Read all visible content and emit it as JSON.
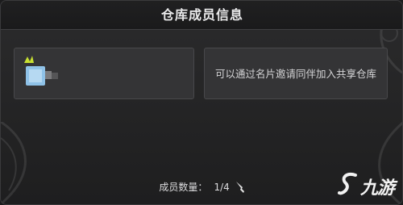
{
  "header": {
    "title": "仓库成员信息"
  },
  "members": [
    {
      "slot": "owner",
      "avatar_icon": "blurred-avatar-icon",
      "name_hidden": true
    }
  ],
  "invite_card": {
    "text": "可以通过名片邀请同伴加入共享仓库"
  },
  "footer": {
    "count_label": "成员数量：",
    "count_value": "1/4",
    "cursor_icon": "quill-pen-icon"
  },
  "watermark": {
    "text": "九游",
    "icon": "swirl-logo-icon"
  },
  "colors": {
    "background": "#262627",
    "card": "#343436",
    "text": "#e9e9ea",
    "avatar_accent": "#8fc2e8",
    "crown": "#c8e032"
  }
}
